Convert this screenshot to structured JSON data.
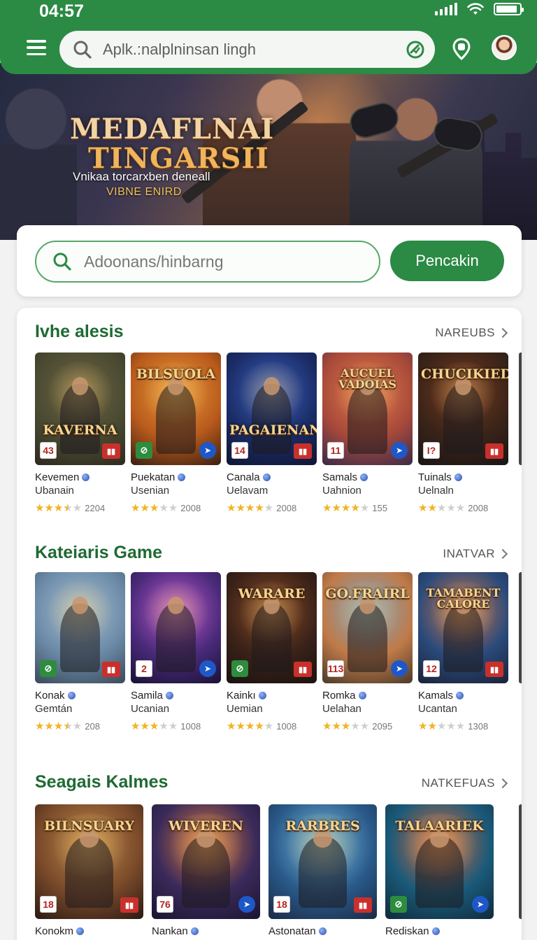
{
  "status_bar": {
    "time": "04:57"
  },
  "header": {
    "search_placeholder": "Aplk.:nalplninsan lingh",
    "icons": [
      "menu-icon",
      "search-icon",
      "ai-icon",
      "location-pin-icon",
      "profile-avatar"
    ]
  },
  "banner": {
    "title_line1": "MEDAFLNAI",
    "title_line2": "TINGARSII",
    "subtitle": "Vnikaa torcarxben deneall",
    "subtitle2": "VIBNE ENIRD"
  },
  "search": {
    "placeholder": "Adoonans/hinbarng",
    "button_label": "Pencakin"
  },
  "colors": {
    "primary": "#2b8a44",
    "title": "#1f6a33",
    "star": "#f2b51d"
  },
  "sections": [
    {
      "title": "Ivhe alesis",
      "more_label": "NAREUBS",
      "items": [
        {
          "name": "Kevemen",
          "dev": "Ubanain",
          "rating": 3.5,
          "count": "2204",
          "art_title": "KAVERNA",
          "badge": "43",
          "palette": [
            "#4a4a32",
            "#6b6240",
            "#2e2a1f"
          ]
        },
        {
          "name": "Puekatan",
          "dev": "Usenian",
          "rating": 3,
          "count": "2008",
          "art_title": "BILSUOLA",
          "badge": "",
          "palette": [
            "#b85a1c",
            "#e89a3a",
            "#3a1f12"
          ]
        },
        {
          "name": "Canala",
          "dev": "Uelavam",
          "rating": 4,
          "count": "2008",
          "art_title": "PAGAIENAN",
          "badge": "14",
          "palette": [
            "#1b2c66",
            "#3860c0",
            "#0f1634"
          ]
        },
        {
          "name": "Samals",
          "dev": "Uahnion",
          "rating": 4,
          "count": "155",
          "art_title": "AUCUEL VADOIAS",
          "badge": "11",
          "palette": [
            "#a84a3a",
            "#e07a4a",
            "#3a2a4a"
          ]
        },
        {
          "name": "Tuinals",
          "dev": "Uelnaln",
          "rating": 2,
          "count": "2008",
          "art_title": "CHUCIKIED",
          "badge": "I?",
          "palette": [
            "#3a2418",
            "#7a3a20",
            "#1a1416"
          ]
        }
      ]
    },
    {
      "title": "Kateiaris Game",
      "more_label": "INATVAR",
      "items": [
        {
          "name": "Konak",
          "dev": "Gemtán",
          "rating": 3.5,
          "count": "208",
          "art_title": "",
          "badge": "",
          "palette": [
            "#6b8aa8",
            "#a8c0d0",
            "#3a4a58"
          ]
        },
        {
          "name": "Samila",
          "dev": "Ucanian",
          "rating": 3,
          "count": "1008",
          "art_title": "",
          "badge": "2",
          "palette": [
            "#4a2a7a",
            "#c05ad0",
            "#1a1236"
          ]
        },
        {
          "name": "Kainkı",
          "dev": "Uemian",
          "rating": 4,
          "count": "1008",
          "art_title": "WARARE",
          "badge": "",
          "palette": [
            "#3a2218",
            "#8a4a28",
            "#1a1210"
          ]
        },
        {
          "name": "Romka",
          "dev": "Uelahan",
          "rating": 3,
          "count": "2095",
          "art_title": "GO.FRAIRL",
          "badge": "113",
          "palette": [
            "#c07a48",
            "#7aa8c8",
            "#4a3a2a"
          ]
        },
        {
          "name": "Kamals",
          "dev": "Ucantan",
          "rating": 2,
          "count": "1308",
          "art_title": "TAMABENT CALORE",
          "badge": "12",
          "palette": [
            "#2a4a7a",
            "#d0784a",
            "#1a2238"
          ]
        }
      ]
    },
    {
      "title": "Seagais Kalmes",
      "more_label": "NATKEFUAS",
      "items": [
        {
          "name": "Konokm",
          "dev": "",
          "rating": 0,
          "count": "",
          "art_title": "BILNSUARY",
          "badge": "18",
          "palette": [
            "#7a4a2a",
            "#c08a4a",
            "#2a1a14"
          ]
        },
        {
          "name": "Nankan",
          "dev": "",
          "rating": 0,
          "count": "",
          "art_title": "WIVEREN",
          "badge": "76",
          "palette": [
            "#3a2a5a",
            "#e07a3a",
            "#1a1430"
          ]
        },
        {
          "name": "Astonatan",
          "dev": "",
          "rating": 0,
          "count": "",
          "art_title": "RARBRES",
          "badge": "18",
          "palette": [
            "#2a5a8a",
            "#7ac0e0",
            "#1a2a44"
          ]
        },
        {
          "name": "Rediskan",
          "dev": "",
          "rating": 0,
          "count": "",
          "art_title": "TALAARIEK",
          "badge": "",
          "palette": [
            "#1a5a7a",
            "#e06a3a",
            "#102a3a"
          ]
        }
      ]
    }
  ]
}
